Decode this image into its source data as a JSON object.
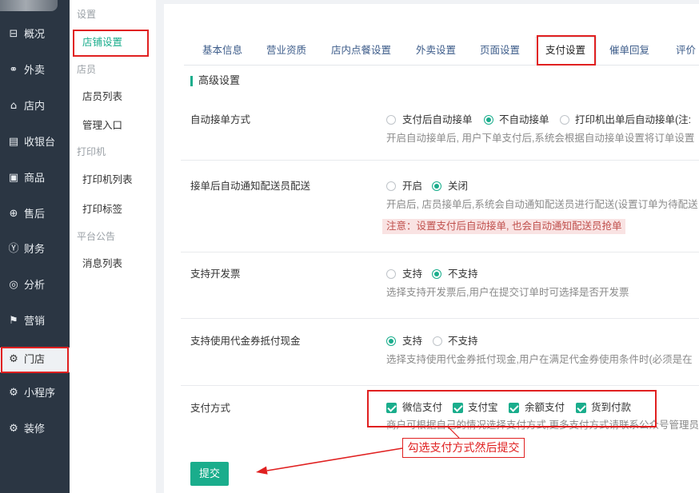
{
  "sidebar": {
    "items": [
      {
        "label": "概况",
        "icon": "overview-icon",
        "active": false
      },
      {
        "label": "外卖",
        "icon": "delivery-icon",
        "active": false
      },
      {
        "label": "店内",
        "icon": "store-icon",
        "active": false
      },
      {
        "label": "收银台",
        "icon": "cashier-icon",
        "active": false
      },
      {
        "label": "商品",
        "icon": "goods-icon",
        "active": false
      },
      {
        "label": "售后",
        "icon": "after-sales-icon",
        "active": false
      },
      {
        "label": "财务",
        "icon": "finance-icon",
        "active": false
      },
      {
        "label": "分析",
        "icon": "analysis-icon",
        "active": false
      },
      {
        "label": "营销",
        "icon": "marketing-icon",
        "active": false
      },
      {
        "label": "门店",
        "icon": "gear-icon",
        "active": true
      },
      {
        "label": "小程序",
        "icon": "gear-icon",
        "active": false
      },
      {
        "label": "装修",
        "icon": "gear-icon",
        "active": false
      }
    ]
  },
  "subnav": {
    "groups": [
      {
        "title": "设置",
        "items": [
          {
            "label": "店铺设置",
            "active": true
          }
        ]
      },
      {
        "title": "店员",
        "items": [
          {
            "label": "店员列表",
            "active": false
          },
          {
            "label": "管理入口",
            "active": false
          }
        ]
      },
      {
        "title": "打印机",
        "items": [
          {
            "label": "打印机列表",
            "active": false
          },
          {
            "label": "打印标签",
            "active": false
          }
        ]
      },
      {
        "title": "平台公告",
        "items": [
          {
            "label": "消息列表",
            "active": false
          }
        ]
      }
    ]
  },
  "tabs": {
    "items": [
      {
        "label": "基本信息",
        "active": false
      },
      {
        "label": "营业资质",
        "active": false
      },
      {
        "label": "店内点餐设置",
        "active": false
      },
      {
        "label": "外卖设置",
        "active": false
      },
      {
        "label": "页面设置",
        "active": false
      },
      {
        "label": "支付设置",
        "active": true
      },
      {
        "label": "催单回复",
        "active": false
      },
      {
        "label": "评价",
        "active": false
      }
    ]
  },
  "section": {
    "title": "高级设置"
  },
  "settings": {
    "auto_accept": {
      "label": "自动接单方式",
      "options": [
        {
          "label": "支付后自动接单",
          "checked": false
        },
        {
          "label": "不自动接单",
          "checked": true
        },
        {
          "label": "打印机出单后自动接单(注:",
          "checked": false
        }
      ],
      "description": "开启自动接单后, 用户下单支付后,系统会根据自动接单设置将订单设置"
    },
    "notify_courier": {
      "label": "接单后自动通知配送员配送",
      "options": [
        {
          "label": "开启",
          "checked": false
        },
        {
          "label": "关闭",
          "checked": true
        }
      ],
      "description": "开启后, 店员接单后,系统会自动通知配送员进行配送(设置订单为待配送",
      "note": "注意：设置支付后自动接单, 也会自动通知配送员抢单"
    },
    "invoice": {
      "label": "支持开发票",
      "options": [
        {
          "label": "支持",
          "checked": false
        },
        {
          "label": "不支持",
          "checked": true
        }
      ],
      "description": "选择支持开发票后,用户在提交订单时可选择是否开发票"
    },
    "voucher": {
      "label": "支持使用代金券抵付现金",
      "options": [
        {
          "label": "支持",
          "checked": true
        },
        {
          "label": "不支持",
          "checked": false
        }
      ],
      "description": "选择支持使用代金券抵付现金,用户在满足代金券使用条件时(必须是在"
    },
    "payment_methods": {
      "label": "支付方式",
      "options": [
        {
          "label": "微信支付",
          "checked": true
        },
        {
          "label": "支付宝",
          "checked": true
        },
        {
          "label": "余额支付",
          "checked": true
        },
        {
          "label": "货到付款",
          "checked": true
        }
      ],
      "description": "商户可根据自己的情况选择支付方式,更多支付方式请联系公众号管理员"
    }
  },
  "form": {
    "submit_label": "提交"
  },
  "annotation": {
    "text": "勾选支付方式然后提交"
  },
  "colors": {
    "accent": "#1aad8c",
    "sidebar": "#2b3643",
    "annotation": "#e02020"
  }
}
